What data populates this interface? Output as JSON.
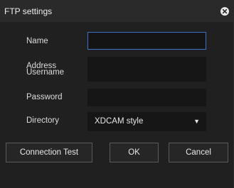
{
  "window": {
    "title": "FTP settings"
  },
  "fields": {
    "name": {
      "label": "Name",
      "value": ""
    },
    "address": {
      "label": "Address",
      "value": ""
    },
    "username": {
      "label": "Username",
      "value": ""
    },
    "password": {
      "label": "Password",
      "value": ""
    },
    "directory": {
      "label": "Directory",
      "selected": "XDCAM style"
    }
  },
  "buttons": {
    "connection_test": "Connection Test",
    "ok": "OK",
    "cancel": "Cancel"
  },
  "icons": {
    "close": "close-icon",
    "dropdown": "triangle-down-icon"
  },
  "colors": {
    "background": "#202020",
    "titlebar": "#2a2a2a",
    "focus_border": "#3a72c8"
  }
}
